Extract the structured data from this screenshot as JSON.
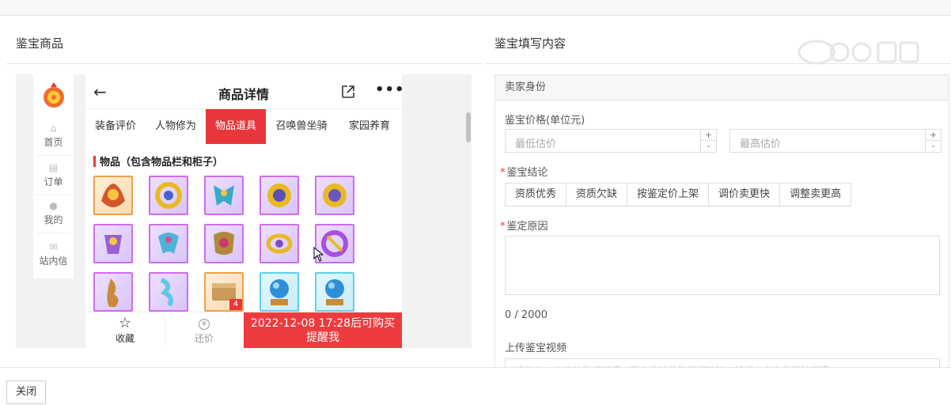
{
  "left": {
    "title": "鉴宝商品"
  },
  "right": {
    "title": "鉴宝填写内容"
  },
  "app": {
    "sidebar": [
      "首页",
      "订单",
      "我的",
      "站内信"
    ],
    "header_title": "商品详情",
    "tabs": [
      "装备评价",
      "人物修为",
      "物品道具",
      "召唤兽坐骑",
      "家园养育"
    ],
    "active_tab": "物品道具",
    "section_title": "物品（包含物品栏和柜子）",
    "item_badge": "4",
    "bottom": {
      "favorite": "收藏",
      "bargain": "还价",
      "bargain_icon": "¥",
      "remind_line1": "2022-12-08 17:28后可购买",
      "remind_line2": "提醒我"
    }
  },
  "form": {
    "panel_title": "卖家身份",
    "price_label": "鉴宝价格(单位元)",
    "min_placeholder": "最低估价",
    "max_placeholder": "最高估价",
    "conclusion_label": "鉴宝结论",
    "conclusion_options": [
      "资质优秀",
      "资质欠缺",
      "按鉴定价上架",
      "调价卖更快",
      "调整卖更高"
    ],
    "reason_label": "鉴定原因",
    "counter": "0 / 2000",
    "video_label": "上传鉴宝视频",
    "video_placeholder": "请先在cc上传待鉴视频后，再在此处粘贴视频链接，视频内容在此下拉评眼"
  },
  "footer": {
    "close_label": "关闭"
  },
  "colors": {
    "accent_red": "#e8363a",
    "item_purple": "#d16bf0",
    "item_cyan": "#5fd0ee",
    "item_orange": "#f0a04a"
  }
}
